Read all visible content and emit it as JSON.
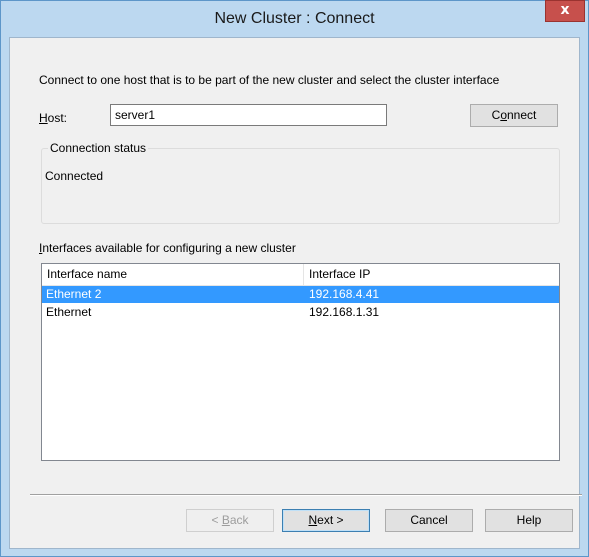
{
  "window": {
    "title": "New Cluster :  Connect",
    "close_glyph": "x"
  },
  "instructions": "Connect to one host that is to be part of the new cluster and select the cluster interface",
  "host": {
    "label_mnemonic": "H",
    "label_rest": "ost:",
    "value": "server1"
  },
  "connect_button": {
    "mnemonic": "o",
    "pre": "C",
    "post": "nnect"
  },
  "connection_status": {
    "title": "Connection status",
    "text": "Connected"
  },
  "interfaces": {
    "label_mnemonic": "I",
    "label_rest": "nterfaces available for configuring a new cluster",
    "columns": [
      "Interface name",
      "Interface IP"
    ],
    "rows": [
      {
        "name": "Ethernet 2",
        "ip": "192.168.4.41",
        "selected": true
      },
      {
        "name": "Ethernet",
        "ip": "192.168.1.31",
        "selected": false
      }
    ]
  },
  "footer": {
    "back": {
      "pre": "< ",
      "mnemonic": "B",
      "post": "ack",
      "disabled": true
    },
    "next": {
      "mnemonic": "N",
      "post": "ext >"
    },
    "cancel": "Cancel",
    "help": "Help"
  },
  "colors": {
    "selection": "#3399ff",
    "frame": "#bcd8f0",
    "close": "#c7504c"
  }
}
